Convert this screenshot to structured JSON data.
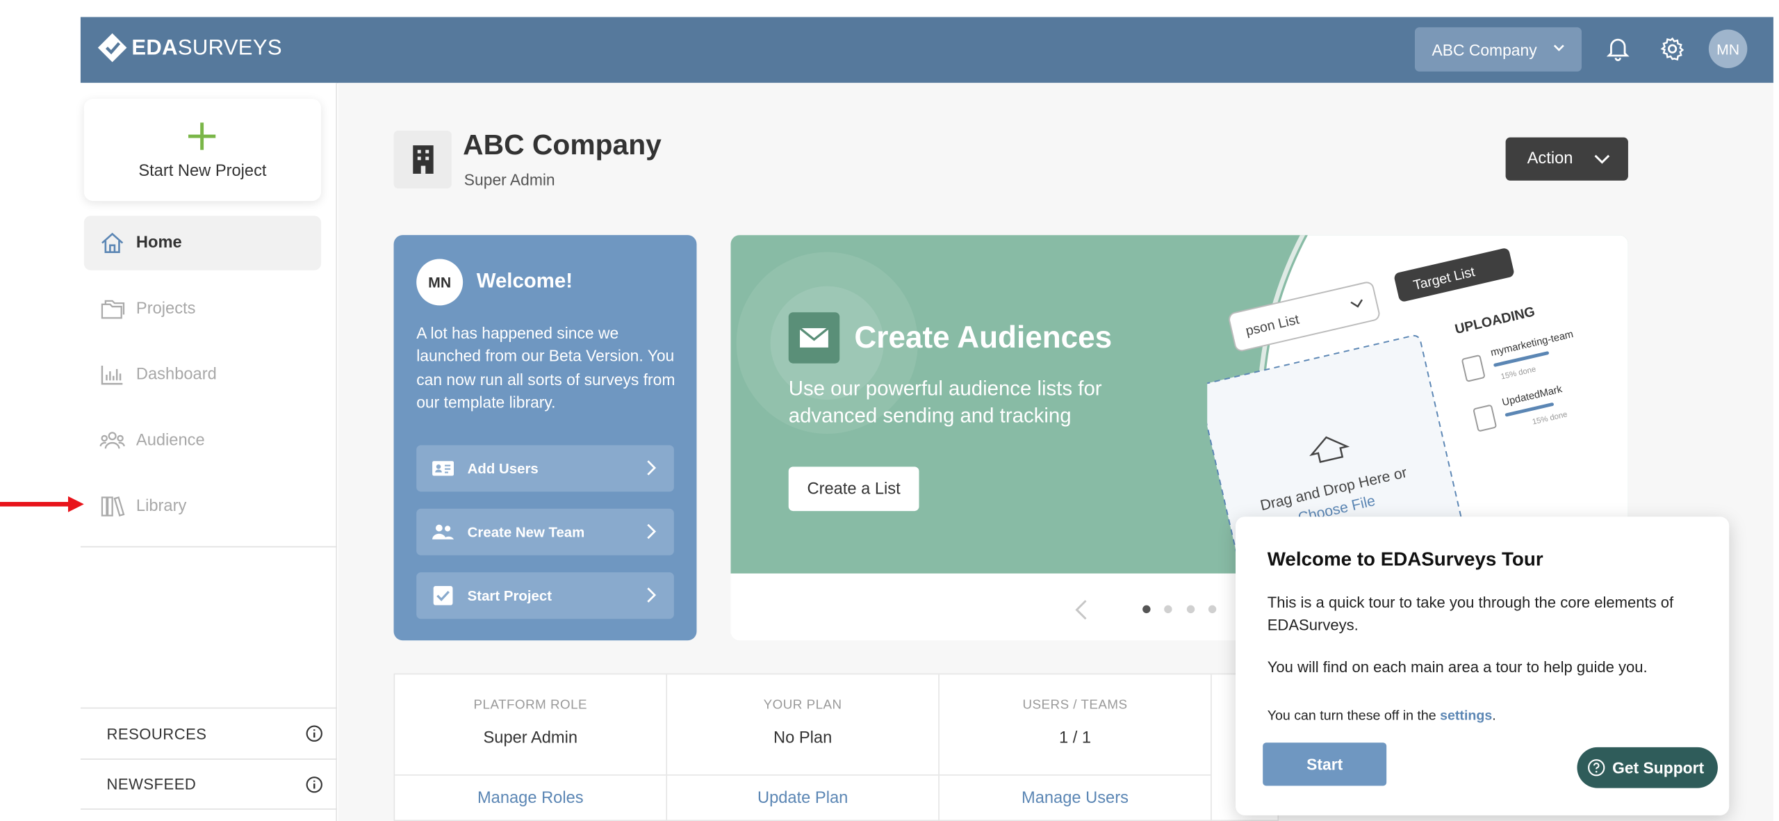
{
  "brand": {
    "bold": "EDA",
    "light": "SURVEYS"
  },
  "topbar": {
    "company_select": "ABC Company",
    "avatar": "MN"
  },
  "sidebar": {
    "new_project": "Start New Project",
    "items": [
      {
        "label": "Home",
        "icon": "home-icon",
        "active": true
      },
      {
        "label": "Projects",
        "icon": "folders-icon"
      },
      {
        "label": "Dashboard",
        "icon": "bar-chart-icon"
      },
      {
        "label": "Audience",
        "icon": "people-icon"
      },
      {
        "label": "Library",
        "icon": "books-icon"
      }
    ],
    "footer": [
      {
        "label": "RESOURCES",
        "icon": "info-icon"
      },
      {
        "label": "NEWSFEED",
        "icon": "info-icon"
      }
    ]
  },
  "header": {
    "title": "ABC Company",
    "role": "Super Admin",
    "action": "Action"
  },
  "welcome": {
    "avatar": "MN",
    "title": "Welcome!",
    "body": "A lot has happened since we launched from our Beta Version. You can now run all sorts of surveys from our template library.",
    "buttons": [
      {
        "label": "Add Users",
        "icon": "id-card-icon"
      },
      {
        "label": "Create New Team",
        "icon": "team-icon"
      },
      {
        "label": "Start Project",
        "icon": "checkbox-icon"
      }
    ]
  },
  "carousel": {
    "title": "Create Audiences",
    "subtitle": "Use our powerful audience lists for advanced sending and tracking",
    "cta": "Create a List",
    "illustration": {
      "select_label": "pson List",
      "tag": "Target List",
      "uploading": "UPLOADING",
      "file1": "mymarketing-team",
      "file2": "UpdatedMark",
      "progress1": "15% done",
      "progress2": "15% done",
      "drop_text": "Drag and Drop Here or",
      "choose": "Choose File"
    }
  },
  "stats": [
    {
      "label": "PLATFORM ROLE",
      "value": "Super Admin",
      "link": "Manage Roles"
    },
    {
      "label": "YOUR PLAN",
      "value": "No Plan",
      "link": "Update Plan"
    },
    {
      "label": "USERS / TEAMS",
      "value": "1 / 1",
      "link": "Manage Users"
    }
  ],
  "tour": {
    "title": "Welcome to EDASurveys Tour",
    "p1": "This is a quick tour to take you through the core elements of EDASurveys.",
    "p2": "You will find on each main area a tour to help guide you.",
    "p3_prefix": "You can turn these off in the ",
    "p3_link": "settings",
    "p3_suffix": ".",
    "start": "Start"
  },
  "support": "Get Support",
  "colors": {
    "topbar": "#56799c",
    "welcome": "#6f97c1",
    "carousel": "#88bba5",
    "support": "#2f5c5a",
    "arrow": "#e8141b"
  }
}
